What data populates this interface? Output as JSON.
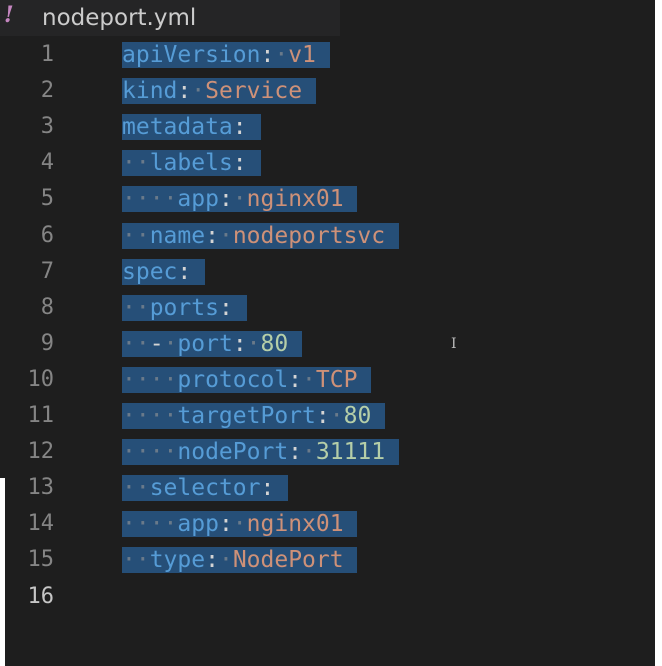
{
  "tab": {
    "icon": "yaml-exclamation-icon",
    "icon_glyph": "!",
    "title": "nodeport.yml"
  },
  "gutter": [
    "1",
    "2",
    "3",
    "4",
    "5",
    "6",
    "7",
    "8",
    "9",
    "10",
    "11",
    "12",
    "13",
    "14",
    "15",
    "16"
  ],
  "lines": [
    {
      "indent": "",
      "key": "apiVersion",
      "colon": ":",
      "sep": " ",
      "value": "v1",
      "vtype": "str"
    },
    {
      "indent": "",
      "key": "kind",
      "colon": ":",
      "sep": " ",
      "value": "Service",
      "vtype": "str"
    },
    {
      "indent": "",
      "key": "metadata",
      "colon": ":",
      "sep": "",
      "value": "",
      "vtype": "str"
    },
    {
      "indent": "  ",
      "key": "labels",
      "colon": ":",
      "sep": "",
      "value": "",
      "vtype": "str"
    },
    {
      "indent": "    ",
      "key": "app",
      "colon": ":",
      "sep": " ",
      "value": "nginx01",
      "vtype": "str"
    },
    {
      "indent": "  ",
      "key": "name",
      "colon": ":",
      "sep": " ",
      "value": "nodeportsvc",
      "vtype": "str"
    },
    {
      "indent": "",
      "key": "spec",
      "colon": ":",
      "sep": "",
      "value": "",
      "vtype": "str"
    },
    {
      "indent": "  ",
      "key": "ports",
      "colon": ":",
      "sep": "",
      "value": "",
      "vtype": "str"
    },
    {
      "indent": "  ",
      "dash": "- ",
      "key": "port",
      "colon": ":",
      "sep": " ",
      "value": "80",
      "vtype": "num"
    },
    {
      "indent": "    ",
      "key": "protocol",
      "colon": ":",
      "sep": " ",
      "value": "TCP",
      "vtype": "str"
    },
    {
      "indent": "    ",
      "key": "targetPort",
      "colon": ":",
      "sep": " ",
      "value": "80",
      "vtype": "num"
    },
    {
      "indent": "    ",
      "key": "nodePort",
      "colon": ":",
      "sep": " ",
      "value": "31111",
      "vtype": "num"
    },
    {
      "indent": "  ",
      "key": "selector",
      "colon": ":",
      "sep": "",
      "value": "",
      "vtype": "str"
    },
    {
      "indent": "    ",
      "key": "app",
      "colon": ":",
      "sep": " ",
      "value": "nginx01",
      "vtype": "str"
    },
    {
      "indent": "  ",
      "key": "type",
      "colon": ":",
      "sep": " ",
      "value": "NodePort",
      "vtype": "str"
    },
    {
      "indent": "",
      "key": "",
      "colon": "",
      "sep": "",
      "value": "",
      "vtype": "str"
    }
  ],
  "active_line": 16,
  "colors": {
    "background": "#1e1e1e",
    "selection": "#264f78",
    "key": "#569cd6",
    "string": "#ce9178",
    "number": "#b5cea8",
    "line_number": "#858585",
    "icon": "#c586c0"
  },
  "cursor_glyph": "I"
}
